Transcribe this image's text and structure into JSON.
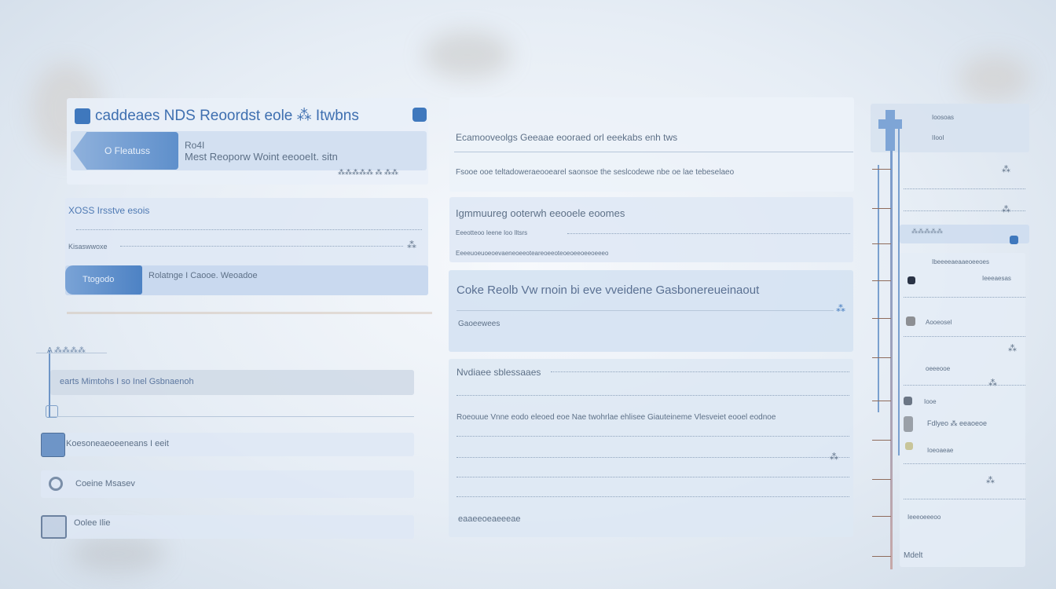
{
  "colors": {
    "accent": "#3f78bd",
    "accent_light": "#6d9bd2",
    "panel": "#dde8f4",
    "text": "#5d7087"
  },
  "records_card": {
    "title": "caddeaes NDS Reoordst eole ⁂ Itwbns",
    "title_icon": "square-icon",
    "corner_button_icon": "square-button-icon",
    "tag_label": "O Fleatuss",
    "detail_line_1": "Ro4I",
    "detail_line_2": "Mest Reoporw Woint eeooeIt. sitn",
    "detail_meta": "⁂⁂⁂⁂⁂ ⁂ ⁂⁂"
  },
  "status_card": {
    "heading": "XOSS Irsstve esois",
    "row_2": "Kisaswwoxe",
    "button_label": "Ttogodo",
    "button_caption": "Rolatnge I Caooe. Weoadoe"
  },
  "left_list": {
    "header": "A ⁂⁂⁂⁂",
    "rows": [
      {
        "icon": "",
        "label": "earts Mimtohs I so Inel Gsbnaenoh"
      },
      {
        "icon": "monitor-icon",
        "label": "Koesoneaeoeeneans I eeit"
      },
      {
        "icon": "circle-icon",
        "label": "Coeine Msasev"
      },
      {
        "icon": "window-icon",
        "label": "Oolee Ilie"
      }
    ]
  },
  "middle": {
    "line_1": "Ecamooveolgs Geeaae eooraed orl eeekabs enh tws",
    "line_2": "Fsooe ooe teltadoweraeooearel saonsoe the seslcodewe nbe oe lae tebeselaeo",
    "section_a_title": "Igmmuureg ooterwh eeooele eoomes",
    "section_a_row_1": "Eeeotteoo Ieene Ioo Iltsrs",
    "section_a_row_2": "Eeeeuoeuoeoevaeneoeeoteareoeeoteoeoeeoeeoeeeo",
    "section_b_title": "Coke Reolb Vw rnoin bi eve vveidene Gasbonereueinaout",
    "section_b_sub": "Gaoeewees",
    "section_c_title": "Nvdiaee sblessaaes",
    "section_c_row_1": "Roeouue Vnne eodo eleoed eoe Nae twohrlae ehlisee Giauteineme Vlesveiet eooel eodnoe",
    "section_c_footer": "eaaeeoeaeeeae"
  },
  "right": {
    "rows": [
      {
        "icon": "",
        "label": "Ioosoas"
      },
      {
        "icon": "",
        "label": "IIooI"
      },
      {
        "icon": "",
        "label": "⁂⁂⁂⁂⁂"
      },
      {
        "icon": "square-button-icon",
        "label": ""
      },
      {
        "icon": "",
        "label": "Ibeeeeaeaaeoeeoes"
      },
      {
        "icon": "dark-square-icon",
        "label": "Ieeeaesas"
      },
      {
        "icon": "gray-square-icon",
        "label": "Aooeosel"
      },
      {
        "icon": "",
        "label": "oeeeooe"
      },
      {
        "icon": "small-square-icon",
        "label": "Iooe"
      },
      {
        "icon": "gray-square-icon",
        "label": "Fdlyeo ⁂ eeaoeoe"
      },
      {
        "icon": "yellow-square-icon",
        "label": "Ioeoaeae"
      },
      {
        "icon": "",
        "label": "Ieeeoeeeoo"
      },
      {
        "icon": "",
        "label": "Mdelt"
      }
    ]
  }
}
